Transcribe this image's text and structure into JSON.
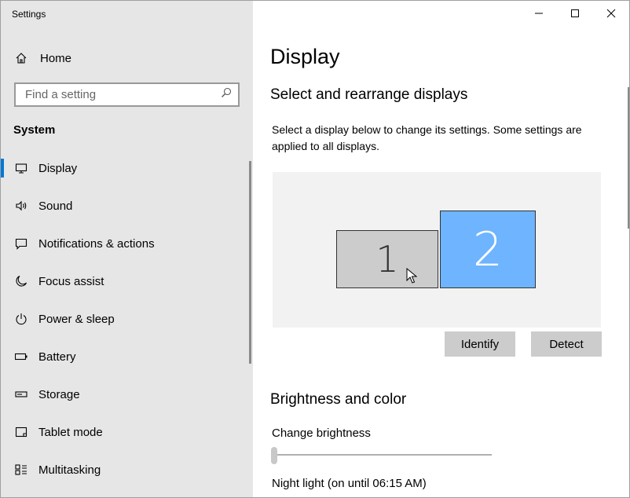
{
  "window": {
    "title": "Settings"
  },
  "sidebar": {
    "home_label": "Home",
    "search_placeholder": "Find a setting",
    "section_title": "System",
    "items": [
      {
        "label": "Display",
        "icon": "monitor-icon"
      },
      {
        "label": "Sound",
        "icon": "speaker-icon"
      },
      {
        "label": "Notifications & actions",
        "icon": "message-icon"
      },
      {
        "label": "Focus assist",
        "icon": "moon-icon"
      },
      {
        "label": "Power & sleep",
        "icon": "power-icon"
      },
      {
        "label": "Battery",
        "icon": "battery-icon"
      },
      {
        "label": "Storage",
        "icon": "storage-icon"
      },
      {
        "label": "Tablet mode",
        "icon": "tablet-icon"
      },
      {
        "label": "Multitasking",
        "icon": "multitasking-icon"
      }
    ],
    "selected_item": "Display"
  },
  "content": {
    "title": "Display",
    "rearrange_heading": "Select and rearrange displays",
    "rearrange_description": "Select a display below to change its settings. Some settings are applied to all displays.",
    "monitors": [
      {
        "label": "1",
        "selected": false,
        "color": "#cccccc"
      },
      {
        "label": "2",
        "selected": true,
        "color": "#6eb4ff"
      }
    ],
    "identify_label": "Identify",
    "detect_label": "Detect",
    "brightness_heading": "Brightness and color",
    "brightness_label": "Change brightness",
    "brightness_value": 0,
    "night_light_label": "Night light (on until 06:15 AM)"
  },
  "colors": {
    "accent": "#0078d7",
    "sidebar_bg": "#e6e6e6",
    "selected_monitor": "#6eb4ff"
  }
}
